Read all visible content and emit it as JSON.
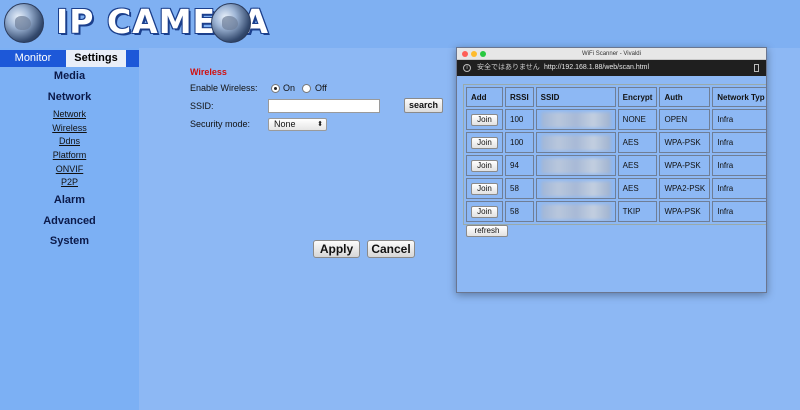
{
  "header": {
    "title": "IP CAMERA"
  },
  "sidebar": {
    "tabs": [
      "Monitor",
      "Settings"
    ],
    "menu": {
      "media": "Media",
      "network": "Network",
      "network_items": [
        "Network",
        "Wireless",
        "Ddns",
        "Platform",
        "ONVIF",
        "P2P"
      ],
      "alarm": "Alarm",
      "advanced": "Advanced",
      "system": "System"
    }
  },
  "form": {
    "title": "Wireless",
    "enable_label": "Enable Wireless:",
    "on_label": "On",
    "off_label": "Off",
    "enabled": true,
    "ssid_label": "SSID:",
    "ssid_value": "",
    "search_label": "search",
    "security_label": "Security mode:",
    "security_value": "None",
    "apply_label": "Apply",
    "cancel_label": "Cancel"
  },
  "popup": {
    "window_title": "WiFi Scanner - Vivaldi",
    "not_secure": "安全ではありません",
    "url": "http://192.168.1.88/web/scan.html",
    "columns": [
      "Add",
      "RSSI",
      "SSID",
      "Encrypt",
      "Auth",
      "Network Typ"
    ],
    "rows": [
      {
        "join": "Join",
        "rssi": "100",
        "encrypt": "NONE",
        "auth": "OPEN",
        "type": "Infra"
      },
      {
        "join": "Join",
        "rssi": "100",
        "encrypt": "AES",
        "auth": "WPA-PSK",
        "type": "Infra"
      },
      {
        "join": "Join",
        "rssi": "94",
        "encrypt": "AES",
        "auth": "WPA-PSK",
        "type": "Infra"
      },
      {
        "join": "Join",
        "rssi": "58",
        "encrypt": "AES",
        "auth": "WPA2-PSK",
        "type": "Infra"
      },
      {
        "join": "Join",
        "rssi": "58",
        "encrypt": "TKIP",
        "auth": "WPA-PSK",
        "type": "Infra"
      }
    ],
    "refresh_label": "refresh"
  },
  "colors": {
    "accent": "#1d58d8",
    "background": "#8db8f4",
    "warning_title": "#d01010"
  },
  "icons": [
    "globe-icon",
    "info-icon",
    "page-icon"
  ]
}
